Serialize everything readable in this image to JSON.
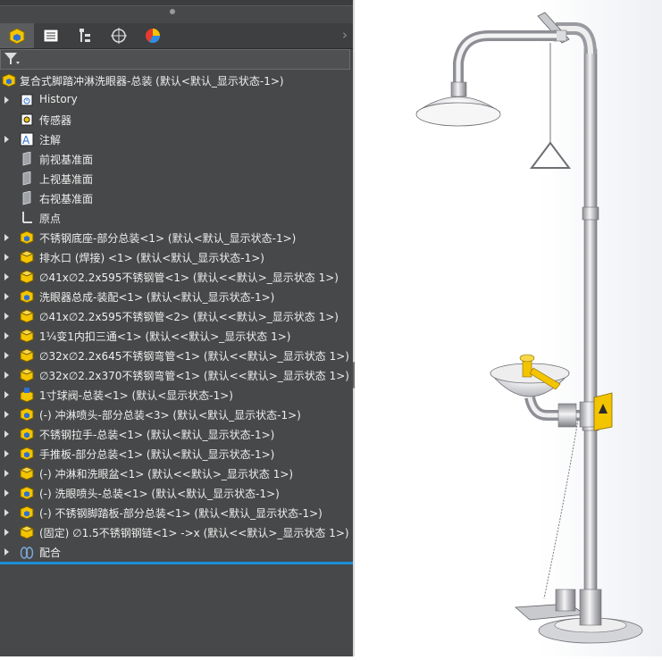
{
  "feature_tree": {
    "root_label": "复合式脚踏冲淋洗眼器-总装 (默认<默认_显示状态-1>)",
    "items": [
      {
        "label": "History",
        "icon": "history-icon",
        "expandable": true
      },
      {
        "label": "传感器",
        "icon": "sensor-icon",
        "expandable": false
      },
      {
        "label": "注解",
        "icon": "annotation-icon",
        "expandable": true
      },
      {
        "label": "前视基准面",
        "icon": "plane-icon",
        "expandable": false
      },
      {
        "label": "上视基准面",
        "icon": "plane-icon",
        "expandable": false
      },
      {
        "label": "右视基准面",
        "icon": "plane-icon",
        "expandable": false
      },
      {
        "label": "原点",
        "icon": "origin-icon",
        "expandable": false
      },
      {
        "label": "不锈钢底座-部分总装<1> (默认<默认_显示状态-1>)",
        "icon": "assembly-icon",
        "expandable": true
      },
      {
        "label": "排水口 (焊接) <1> (默认<默认_显示状态-1>)",
        "icon": "part-icon",
        "expandable": true
      },
      {
        "label": "∅41x∅2.2x595不锈钢管<1> (默认<<默认>_显示状态 1>)",
        "icon": "part-icon",
        "expandable": true
      },
      {
        "label": "洗眼器总成-装配<1> (默认<默认_显示状态-1>)",
        "icon": "assembly-icon",
        "expandable": true
      },
      {
        "label": "∅41x∅2.2x595不锈钢管<2> (默认<<默认>_显示状态 1>)",
        "icon": "part-icon",
        "expandable": true
      },
      {
        "label": "1¼变1内扣三通<1> (默认<<默认>_显示状态 1>)",
        "icon": "part-icon",
        "expandable": true
      },
      {
        "label": "∅32x∅2.2x645不锈钢弯管<1> (默认<<默认>_显示状态 1>)",
        "icon": "part-icon",
        "expandable": true
      },
      {
        "label": "∅32x∅2.2x370不锈钢弯管<1> (默认<<默认>_显示状态 1>)",
        "icon": "part-icon",
        "expandable": true
      },
      {
        "label": "1寸球阀-总装<1> (默认<显示状态-1>)",
        "icon": "valve-assembly-icon",
        "expandable": true
      },
      {
        "label": "(-) 冲淋喷头-部分总装<3> (默认<默认_显示状态-1>)",
        "icon": "assembly-icon",
        "expandable": true
      },
      {
        "label": "不锈钢拉手-总装<1> (默认<默认_显示状态-1>)",
        "icon": "assembly-icon",
        "expandable": true
      },
      {
        "label": "手推板-部分总装<1> (默认<默认_显示状态-1>)",
        "icon": "assembly-icon",
        "expandable": true
      },
      {
        "label": "(-) 冲淋和洗眼盆<1> (默认<<默认>_显示状态 1>)",
        "icon": "part-icon",
        "expandable": true
      },
      {
        "label": "(-) 洗眼喷头-总装<1> (默认<默认_显示状态-1>)",
        "icon": "assembly-icon",
        "expandable": true
      },
      {
        "label": "(-) 不锈钢脚踏板-部分总装<1> (默认<默认_显示状态-1>)",
        "icon": "assembly-icon",
        "expandable": true
      },
      {
        "label": "(固定) ∅1.5不锈钢钢链<1> ->x (默认<<默认>_显示状态 1>)",
        "icon": "part-icon",
        "expandable": true
      },
      {
        "label": "配合",
        "icon": "mates-icon",
        "expandable": true
      }
    ]
  },
  "tabs": [
    "feature-manager",
    "property-manager",
    "configuration-manager",
    "dimxpert-manager",
    "display-manager"
  ],
  "colors": {
    "panel_bg": "#474849",
    "accent": "#1e8fd6",
    "part_yellow": "#f3c400",
    "part_blue": "#2f6fd0"
  }
}
